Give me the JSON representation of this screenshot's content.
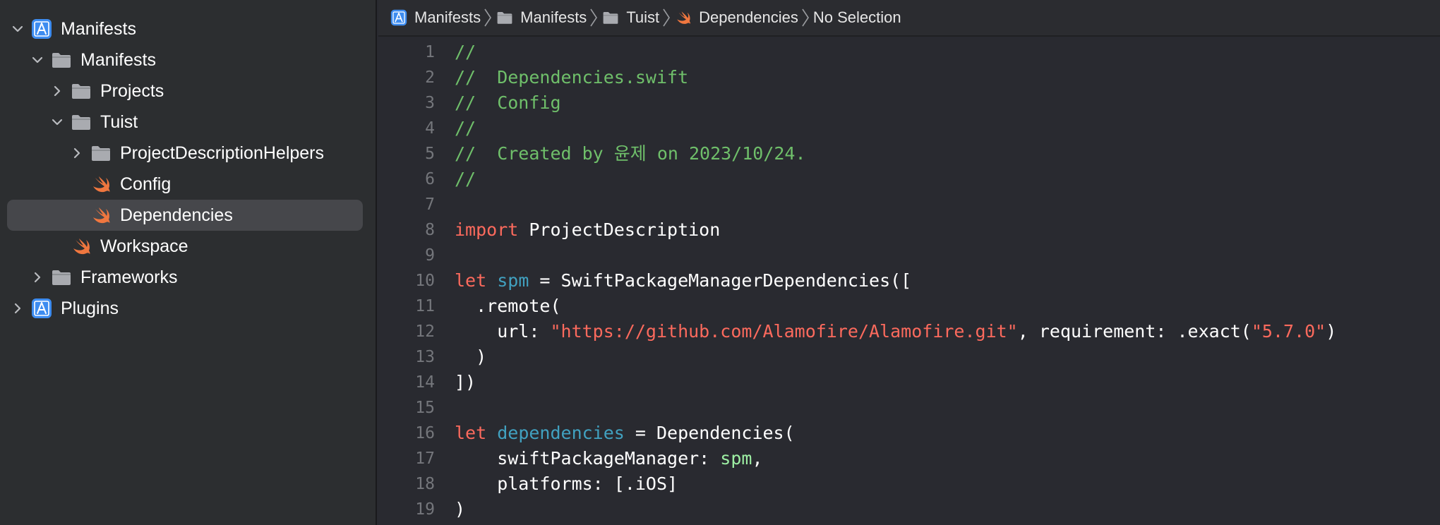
{
  "colors": {
    "sidebar_bg": "#2c2e30",
    "editor_bg": "#292a30",
    "selection_bg": "#46474b",
    "comment": "#6fbf6a",
    "keyword": "#fc6a5d",
    "string": "#fc6a5d",
    "declaration": "#41a1c0",
    "reference": "#9ef0a4",
    "line_number": "#74767b",
    "folder_icon": "#a9abb0",
    "swift_icon": "#f0773f",
    "project_icon": "#3d8cf0"
  },
  "navigator": {
    "items": [
      {
        "label": "Manifests",
        "icon": "xcode-project-icon",
        "disclosure": "expanded"
      },
      {
        "label": "Manifests",
        "icon": "folder-icon",
        "disclosure": "expanded"
      },
      {
        "label": "Projects",
        "icon": "folder-icon",
        "disclosure": "collapsed"
      },
      {
        "label": "Tuist",
        "icon": "folder-icon",
        "disclosure": "expanded"
      },
      {
        "label": "ProjectDescriptionHelpers",
        "icon": "folder-icon",
        "disclosure": "collapsed"
      },
      {
        "label": "Config",
        "icon": "swift-file-icon",
        "disclosure": "none"
      },
      {
        "label": "Dependencies",
        "icon": "swift-file-icon",
        "disclosure": "none",
        "selected": true
      },
      {
        "label": "Workspace",
        "icon": "swift-file-icon",
        "disclosure": "none"
      },
      {
        "label": "Frameworks",
        "icon": "folder-icon",
        "disclosure": "collapsed"
      },
      {
        "label": "Plugins",
        "icon": "xcode-project-icon",
        "disclosure": "collapsed"
      }
    ]
  },
  "jumpbar": {
    "crumbs": [
      {
        "label": "Manifests",
        "icon": "xcode-project-icon"
      },
      {
        "label": "Manifests",
        "icon": "folder-icon"
      },
      {
        "label": "Tuist",
        "icon": "folder-icon"
      },
      {
        "label": "Dependencies",
        "icon": "swift-file-icon"
      },
      {
        "label": "No Selection",
        "icon": ""
      }
    ]
  },
  "editor": {
    "file_name": "Dependencies.swift",
    "lines": [
      {
        "number": "1",
        "tokens": [
          {
            "t": "comment",
            "v": "//"
          }
        ]
      },
      {
        "number": "2",
        "tokens": [
          {
            "t": "comment",
            "v": "//  Dependencies.swift"
          }
        ]
      },
      {
        "number": "3",
        "tokens": [
          {
            "t": "comment",
            "v": "//  Config"
          }
        ]
      },
      {
        "number": "4",
        "tokens": [
          {
            "t": "comment",
            "v": "//"
          }
        ]
      },
      {
        "number": "5",
        "tokens": [
          {
            "t": "comment",
            "v": "//  Created by 윤제 on 2023/10/24."
          }
        ]
      },
      {
        "number": "6",
        "tokens": [
          {
            "t": "comment",
            "v": "//"
          }
        ]
      },
      {
        "number": "7",
        "tokens": []
      },
      {
        "number": "8",
        "tokens": [
          {
            "t": "keyword",
            "v": "import"
          },
          {
            "t": "plain",
            "v": " ProjectDescription"
          }
        ]
      },
      {
        "number": "9",
        "tokens": []
      },
      {
        "number": "10",
        "tokens": [
          {
            "t": "keyword",
            "v": "let"
          },
          {
            "t": "plain",
            "v": " "
          },
          {
            "t": "decl2",
            "v": "spm"
          },
          {
            "t": "plain",
            "v": " = SwiftPackageManagerDependencies(["
          }
        ]
      },
      {
        "number": "11",
        "tokens": [
          {
            "t": "plain",
            "v": "  .remote("
          }
        ]
      },
      {
        "number": "12",
        "tokens": [
          {
            "t": "plain",
            "v": "    url: "
          },
          {
            "t": "string",
            "v": "\"https://github.com/Alamofire/Alamofire.git\""
          },
          {
            "t": "plain",
            "v": ", requirement: .exact("
          },
          {
            "t": "string",
            "v": "\"5.7.0\""
          },
          {
            "t": "plain",
            "v": ")"
          }
        ]
      },
      {
        "number": "13",
        "tokens": [
          {
            "t": "plain",
            "v": "  )"
          }
        ]
      },
      {
        "number": "14",
        "tokens": [
          {
            "t": "plain",
            "v": "])"
          }
        ]
      },
      {
        "number": "15",
        "tokens": []
      },
      {
        "number": "16",
        "tokens": [
          {
            "t": "keyword",
            "v": "let"
          },
          {
            "t": "plain",
            "v": " "
          },
          {
            "t": "decl2",
            "v": "dependencies"
          },
          {
            "t": "plain",
            "v": " = Dependencies("
          }
        ]
      },
      {
        "number": "17",
        "tokens": [
          {
            "t": "plain",
            "v": "    swiftPackageManager: "
          },
          {
            "t": "ref2",
            "v": "spm"
          },
          {
            "t": "plain",
            "v": ","
          }
        ]
      },
      {
        "number": "18",
        "tokens": [
          {
            "t": "plain",
            "v": "    platforms: [.iOS]"
          }
        ]
      },
      {
        "number": "19",
        "tokens": [
          {
            "t": "plain",
            "v": ")"
          }
        ]
      }
    ]
  }
}
